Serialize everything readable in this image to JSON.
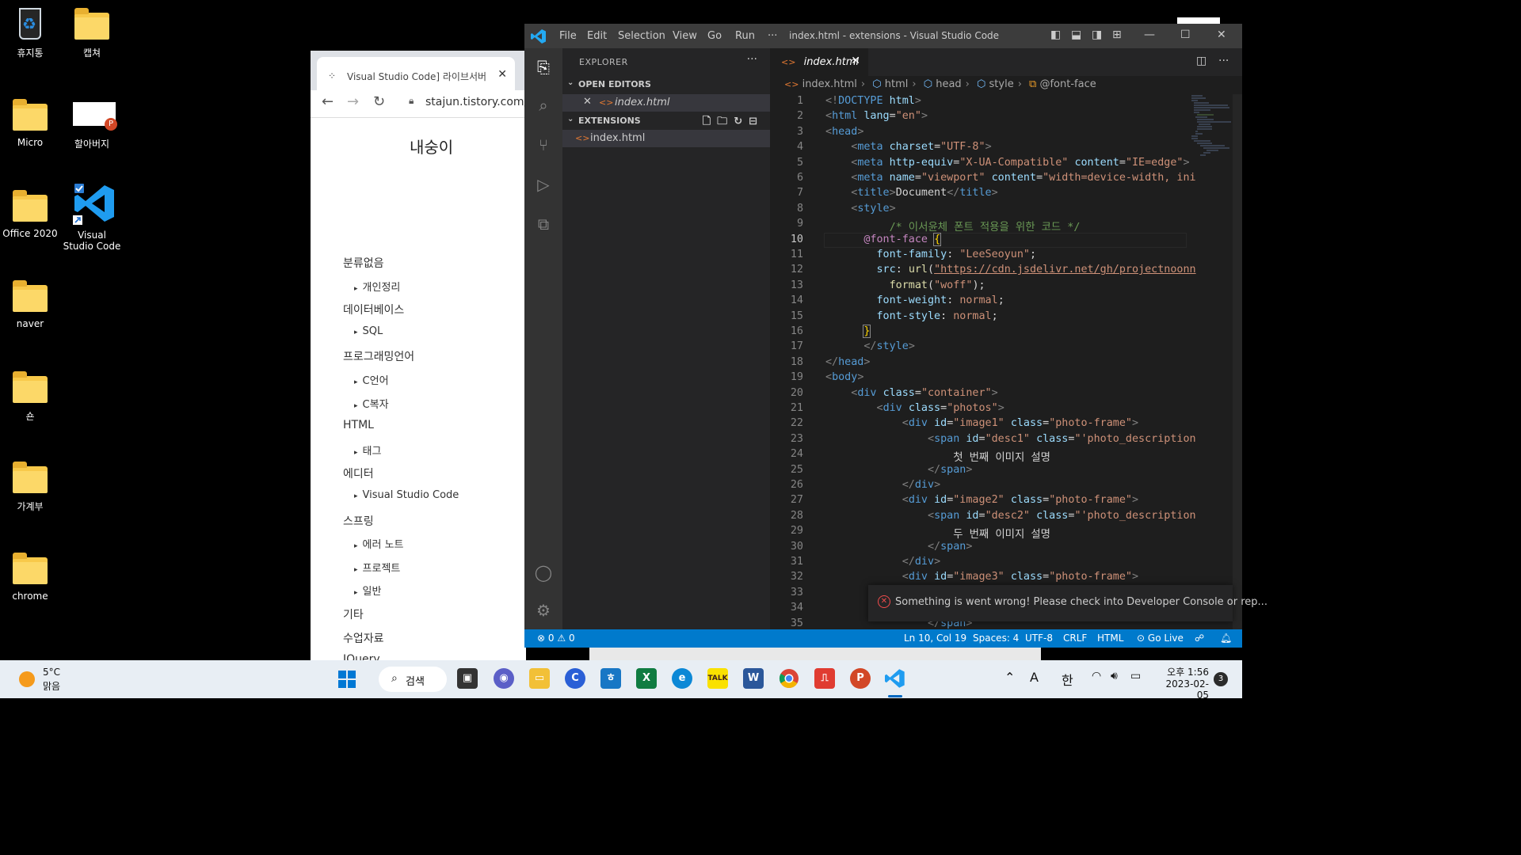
{
  "desktop": {
    "icons": [
      {
        "label": "휴지통",
        "icon": "recycle-bin-icon"
      },
      {
        "label": "캡쳐",
        "icon": "folder-icon"
      },
      {
        "label": "Micro",
        "icon": "folder-icon"
      },
      {
        "label": "할아버지",
        "icon": "powerpoint-file-icon"
      },
      {
        "label": "Office 2020",
        "icon": "folder-icon"
      },
      {
        "label": "Visual Studio Code",
        "icon": "vscode-shortcut-icon"
      },
      {
        "label": "naver",
        "icon": "folder-icon"
      },
      {
        "label": "숀",
        "icon": "folder-icon"
      },
      {
        "label": "가계부",
        "icon": "folder-icon"
      },
      {
        "label": "chrome",
        "icon": "folder-icon"
      }
    ]
  },
  "browser": {
    "tab_title": "Visual Studio Code] 라이브서버",
    "url": "stajun.tistory.com/e",
    "blog_title": "내숭이",
    "categories": [
      {
        "label": "분류없음",
        "subs": [
          "개인정리"
        ]
      },
      {
        "label": "데이터베이스",
        "subs": [
          "SQL"
        ]
      },
      {
        "label": "프로그래밍언어",
        "subs": [
          "C언어",
          "C복자"
        ]
      },
      {
        "label": "HTML",
        "subs": [
          "태그"
        ]
      },
      {
        "label": "에디터",
        "subs": [
          "Visual Studio Code"
        ]
      },
      {
        "label": "스프링",
        "subs": [
          "에러 노트",
          "프로젝트",
          "일반"
        ]
      },
      {
        "label": "기타",
        "subs": []
      },
      {
        "label": "수업자료",
        "subs": []
      }
    ],
    "cut_off_text": "JQuery"
  },
  "vscode": {
    "menu": [
      "File",
      "Edit",
      "Selection",
      "View",
      "Go",
      "Run",
      "···"
    ],
    "window_title": "index.html - extensions - Visual Studio Code",
    "explorer_title": "EXPLORER",
    "open_editors_label": "OPEN EDITORS",
    "open_editor_file": "index.html",
    "folder_label": "EXTENSIONS",
    "folder_file": "index.html",
    "active_tab": "index.html",
    "breadcrumb": [
      "index.html",
      "html",
      "head",
      "style",
      "@font-face"
    ],
    "current_line": 10,
    "toast_message": "Something is went wrong! Please check into Developer Console or rep...",
    "status": {
      "errors": "0",
      "warnings": "0",
      "position": "Ln 10, Col 19",
      "spaces": "Spaces: 4",
      "encoding": "UTF-8",
      "eol": "CRLF",
      "language": "HTML",
      "go_live": "Go Live"
    },
    "accent_color": "#007acc"
  },
  "taskbar": {
    "temperature": "5°C",
    "condition": "맑음",
    "search_label": "검색",
    "time": "오후 1:56",
    "date": "2023-02-05",
    "notification_count": "3",
    "ime_a": "A",
    "ime_han": "한"
  }
}
